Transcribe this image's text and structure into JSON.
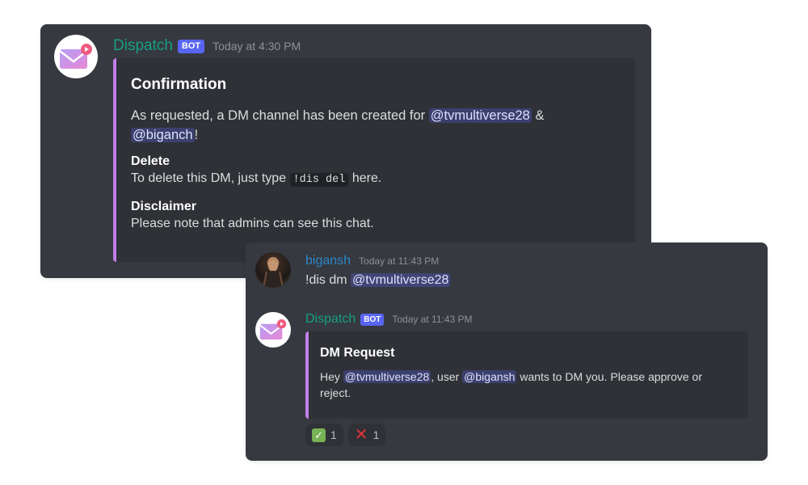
{
  "colors": {
    "card_bg": "#36393f",
    "embed_bg": "#2f3136",
    "embed_accent": "#c27ee8",
    "bot_name": "#16a085",
    "user_name": "#2c87c9",
    "bot_tag": "#5865f2",
    "mention_bg": "#5865f24d"
  },
  "card1": {
    "avatar_icon": "envelope-icon",
    "author": "Dispatch",
    "tag": "BOT",
    "timestamp": "Today at 4:30 PM",
    "embed": {
      "title": "Confirmation",
      "desc_prefix": "As requested, a DM channel has been created for",
      "mention1": "@tvmultiverse28",
      "amp": "&",
      "mention2": "@biganch",
      "bang": "!",
      "field1_name": "Delete",
      "field1_before": "To delete this DM, just type",
      "field1_code": "!dis del",
      "field1_after": "here.",
      "field2_name": "Disclaimer",
      "field2_value": "Please note that admins can see this chat."
    }
  },
  "card2": {
    "user_message": {
      "author": "bigansh",
      "timestamp": "Today at 11:43 PM",
      "command": "!dis dm",
      "mention": "@tvmultiverse28"
    },
    "bot_message": {
      "avatar_icon": "envelope-icon",
      "author": "Dispatch",
      "tag": "BOT",
      "timestamp": "Today at 11:43 PM",
      "embed": {
        "title": "DM Request",
        "hey": "Hey",
        "mention1": "@tvmultiverse28",
        "mid": ", user",
        "mention2": "@bigansh",
        "rest": "wants to DM you. Please approve or reject."
      },
      "reactions": [
        {
          "emoji": "white-check-mark",
          "count": "1"
        },
        {
          "emoji": "x-mark",
          "count": "1"
        }
      ]
    }
  }
}
